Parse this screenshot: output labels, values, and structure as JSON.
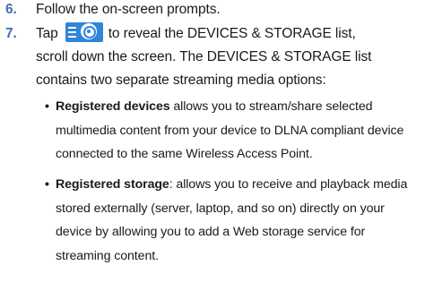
{
  "steps": [
    {
      "number": "6.",
      "lines": [
        "Follow the on-screen prompts."
      ]
    },
    {
      "number": "7.",
      "prefix": "Tap",
      "icon": "devices-app-icon",
      "line1_rest": "to reveal the DEVICES & STORAGE list,",
      "lines": [
        "scroll down the screen. The DEVICES & STORAGE list",
        "contains two separate streaming media options:"
      ]
    }
  ],
  "bullets": [
    {
      "term": "Registered devices",
      "first_line": " allows you to stream/share selected",
      "lines": [
        "multimedia content from your device to DLNA compliant device",
        "connected to the same Wireless Access Point."
      ]
    },
    {
      "term": "Registered storage",
      "first_line": ": allows you to receive and playback media",
      "lines": [
        "stored externally (server, laptop, and so on) directly on your",
        "device by allowing you to add a Web storage service for",
        "streaming content."
      ]
    }
  ],
  "colors": {
    "step_number": "#3d6fb4",
    "icon_background": "#2f86d8"
  }
}
